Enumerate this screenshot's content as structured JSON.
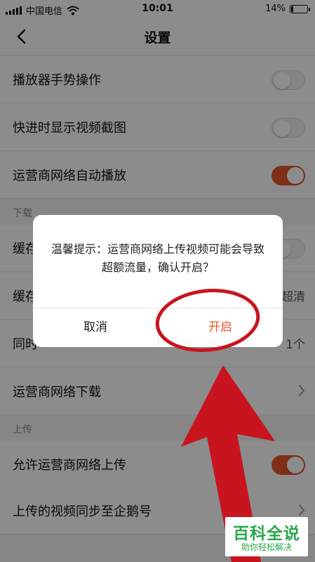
{
  "status_bar": {
    "carrier": "中国电信",
    "time": "10:01",
    "battery": "14%",
    "battery_level": 0.14
  },
  "nav": {
    "title": "设置"
  },
  "settings": {
    "gesture": {
      "label": "播放器手势操作",
      "enabled": false
    },
    "seek_preview": {
      "label": "快进时显示视频截图",
      "enabled": false
    },
    "autoplay_mobile": {
      "label": "运营商网络自动播放",
      "enabled": true
    },
    "download_section": "下载",
    "cache_row1": {
      "label": "缓存",
      "enabled": false
    },
    "cache_row2": {
      "label": "缓存",
      "value": "超清"
    },
    "simultaneous": {
      "label": "同时",
      "value": "1个"
    },
    "mobile_download": {
      "label": "运营商网络下载"
    },
    "upload_section": "上传",
    "allow_mobile_upload": {
      "label": "允许运营商网络上传",
      "enabled": true
    },
    "sync_penguin": {
      "label": "上传的视频同步至企鹅号"
    }
  },
  "dialog": {
    "message": "温馨提示：运营商网络上传视频可能会导致超额流量，确认开启？",
    "cancel_label": "取消",
    "confirm_label": "开启"
  },
  "watermark": {
    "title": "百科全说",
    "subtitle": "助你轻松解决"
  },
  "colors": {
    "accent": "#e8562a",
    "annotation": "#c8141e",
    "watermark": "#2aa64b"
  }
}
